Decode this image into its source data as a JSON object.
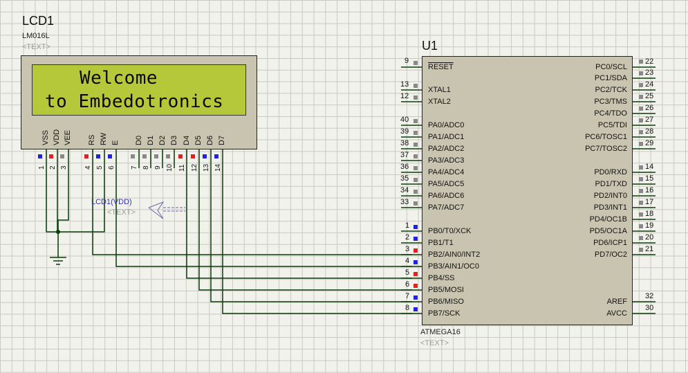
{
  "lcd": {
    "ref": "LCD1",
    "model": "LM016L",
    "text_placeholder": "<TEXT>",
    "line1": "Welcome",
    "line2": "to Embedotronics",
    "pin_labels": [
      "VSS",
      "VDD",
      "VEE",
      "RS",
      "RW",
      "E",
      "D0",
      "D1",
      "D2",
      "D3",
      "D4",
      "D5",
      "D6",
      "D7"
    ],
    "pin_numbers": [
      "1",
      "2",
      "3",
      "4",
      "5",
      "6",
      "7",
      "8",
      "9",
      "10",
      "11",
      "12",
      "13",
      "14"
    ]
  },
  "power_label": {
    "name": "LCD1(VDD)",
    "text": "<TEXT>"
  },
  "mcu": {
    "ref": "U1",
    "model": "ATMEGA16",
    "text_placeholder": "<TEXT>",
    "left_pins": [
      {
        "num": "9",
        "name": "RESET"
      },
      {
        "num": "13",
        "name": "XTAL1"
      },
      {
        "num": "12",
        "name": "XTAL2"
      },
      {
        "num": "40",
        "name": "PA0/ADC0"
      },
      {
        "num": "39",
        "name": "PA1/ADC1"
      },
      {
        "num": "38",
        "name": "PA2/ADC2"
      },
      {
        "num": "37",
        "name": "PA3/ADC3"
      },
      {
        "num": "36",
        "name": "PA4/ADC4"
      },
      {
        "num": "35",
        "name": "PA5/ADC5"
      },
      {
        "num": "34",
        "name": "PA6/ADC6"
      },
      {
        "num": "33",
        "name": "PA7/ADC7"
      },
      {
        "num": "1",
        "name": "PB0/T0/XCK"
      },
      {
        "num": "2",
        "name": "PB1/T1"
      },
      {
        "num": "3",
        "name": "PB2/AIN0/INT2"
      },
      {
        "num": "4",
        "name": "PB3/AIN1/OC0"
      },
      {
        "num": "5",
        "name": "PB4/SS"
      },
      {
        "num": "6",
        "name": "PB5/MOSI"
      },
      {
        "num": "7",
        "name": "PB6/MISO"
      },
      {
        "num": "8",
        "name": "PB7/SCK"
      }
    ],
    "right_pins": [
      {
        "num": "22",
        "name": "PC0/SCL"
      },
      {
        "num": "23",
        "name": "PC1/SDA"
      },
      {
        "num": "24",
        "name": "PC2/TCK"
      },
      {
        "num": "25",
        "name": "PC3/TMS"
      },
      {
        "num": "26",
        "name": "PC4/TDO"
      },
      {
        "num": "27",
        "name": "PC5/TDI"
      },
      {
        "num": "28",
        "name": "PC6/TOSC1"
      },
      {
        "num": "29",
        "name": "PC7/TOSC2"
      },
      {
        "num": "14",
        "name": "PD0/RXD"
      },
      {
        "num": "15",
        "name": "PD1/TXD"
      },
      {
        "num": "16",
        "name": "PD2/INT0"
      },
      {
        "num": "17",
        "name": "PD3/INT1"
      },
      {
        "num": "18",
        "name": "PD4/OC1B"
      },
      {
        "num": "19",
        "name": "PD5/OC1A"
      },
      {
        "num": "20",
        "name": "PD6/ICP1"
      },
      {
        "num": "21",
        "name": "PD7/OC2"
      },
      {
        "num": "32",
        "name": "AREF"
      },
      {
        "num": "30",
        "name": "AVCC"
      }
    ]
  },
  "colors": {
    "wire": "#0b3d0b",
    "pin_active": "#2222dd",
    "pin_low": "#dd2222",
    "pin_idle": "#888888"
  }
}
